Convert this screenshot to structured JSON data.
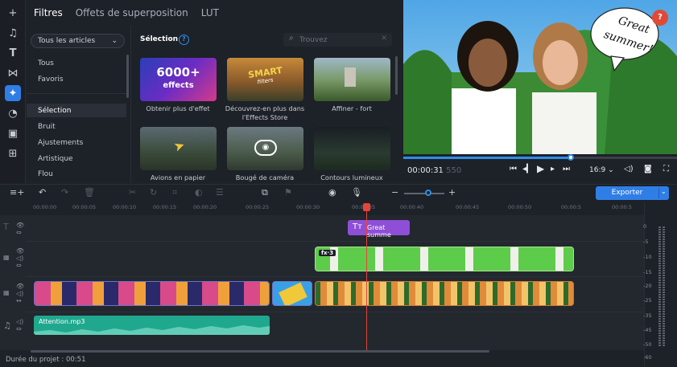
{
  "tabs": [
    {
      "label": "Filtres",
      "active": true
    },
    {
      "label": "Offets de superposition",
      "active": false
    },
    {
      "label": "LUT",
      "active": false
    }
  ],
  "left_toolbar": [
    "plus-icon",
    "music-note-icon",
    "text-icon",
    "transition-icon",
    "magic-wand-icon",
    "clock-icon",
    "stickers-icon",
    "more-tools-icon"
  ],
  "filter_panel": {
    "dropdown": "Tous les articles",
    "categories_top": [
      "Tous",
      "Favoris"
    ],
    "categories": [
      "Sélection",
      "Bruit",
      "Ajustements",
      "Artistique",
      "Flou"
    ],
    "selected_category": "Sélection"
  },
  "gallery": {
    "heading": "Sélection",
    "search_placeholder": "Trouvez",
    "items": [
      {
        "label": "Obtenir plus d'effet",
        "badge_line1": "6000+",
        "badge_line2": "effects"
      },
      {
        "label": "Découvrez-en plus dans l'Effects Store",
        "badge_line1": "SMART",
        "badge_line2": "filters"
      },
      {
        "label": "Affiner - fort"
      },
      {
        "label": "Avions en papier"
      },
      {
        "label": "Bougé de caméra"
      },
      {
        "label": "Contours lumineux"
      }
    ]
  },
  "preview": {
    "bubble_text": "Great summer!",
    "help_badge": "?",
    "timecode_main": "00:00:31",
    "timecode_frac": "550",
    "aspect": "16:9",
    "progress": 0.62
  },
  "toolbar": {
    "export_label": "Exporter"
  },
  "ruler": [
    "00:00:00",
    "00:00:05",
    "00:00:10",
    "00:00:15",
    "00:00:20",
    "00:00:25",
    "00:00:30",
    "00:00:35",
    "00:00:40",
    "00:00:45",
    "00:00:50",
    "00:00:5"
  ],
  "timeline": {
    "title_clip": "Great summe",
    "fx_badge": "fx·3",
    "audio_clip": "Attention.mp3"
  },
  "meter_db": [
    "0",
    "-5",
    "-10",
    "-15",
    "-20",
    "-25",
    "-30",
    "-35",
    "-40",
    "-45",
    "-50",
    "-60"
  ],
  "status": {
    "duration": "Durée du projet : 00:51"
  },
  "colors": {
    "accent": "#2f7ee6",
    "playhead": "#e8433a",
    "title_clip": "#8e4fd6",
    "audio_clip": "#1fa88e",
    "green_clip": "#5dcc4a"
  }
}
